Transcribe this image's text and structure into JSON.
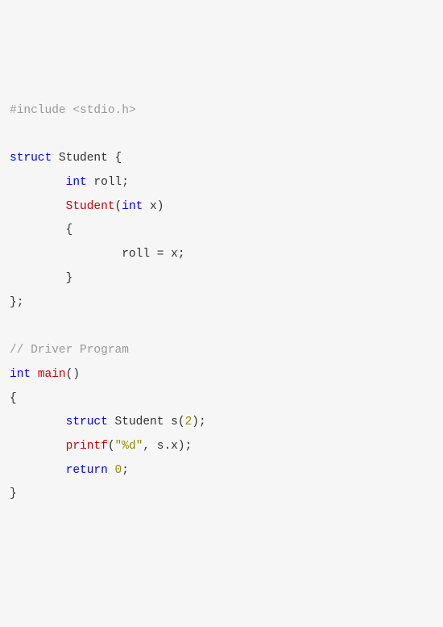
{
  "code": {
    "line1_preproc": "#include",
    "line1_header": " <stdio.h>",
    "line3_struct": "struct",
    "line3_name": " Student ",
    "line3_brace": "{",
    "line4_type": "int",
    "line4_rest": " roll;",
    "line5_ctor": "Student",
    "line5_paren_open": "(",
    "line5_param_type": "int",
    "line5_param_name": " x",
    "line5_paren_close": ")",
    "line6_brace": "{",
    "line7_stmt": "roll = x;",
    "line8_brace": "}",
    "line9_close": "};",
    "line11_comment": "// Driver Program",
    "line12_type": "int",
    "line12_space": " ",
    "line12_main": "main",
    "line12_parens": "()",
    "line13_brace": "{",
    "line14_struct": "struct",
    "line14_decl": " Student s",
    "line14_paren_open": "(",
    "line14_arg": "2",
    "line14_paren_close": ");",
    "line15_printf": "printf",
    "line15_paren_open": "(",
    "line15_str": "\"%d\"",
    "line15_rest": ", s.x);",
    "line16_return": "return",
    "line16_space": " ",
    "line16_zero": "0",
    "line16_semi": ";",
    "line17_brace": "}"
  },
  "indent": {
    "l1": "        ",
    "l2": "                "
  }
}
